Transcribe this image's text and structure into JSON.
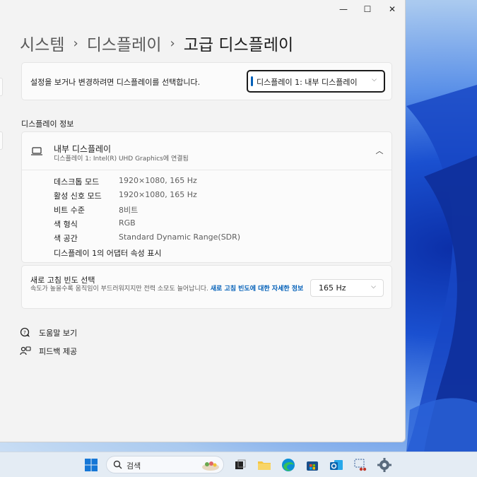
{
  "window": {
    "controls": {
      "minimize": "—",
      "maximize": "☐",
      "close": "✕"
    }
  },
  "breadcrumb": {
    "items": [
      "시스템",
      "디스플레이",
      "고급 디스플레이"
    ],
    "separator": "›"
  },
  "display_select": {
    "label": "설정을 보거나 변경하려면 디스플레이를 선택합니다.",
    "value": "디스플레이 1: 내부 디스플레이"
  },
  "display_info": {
    "section_title": "디스플레이 정보",
    "name": "내부 디스플레이",
    "subtitle": "디스플레이 1: Intel(R) UHD Graphics에 연결됨",
    "specs": [
      {
        "label": "데스크톱 모드",
        "value": "1920×1080, 165 Hz"
      },
      {
        "label": "활성 신호 모드",
        "value": "1920×1080, 165 Hz"
      },
      {
        "label": "비트 수준",
        "value": "8비트"
      },
      {
        "label": "색 형식",
        "value": "RGB"
      },
      {
        "label": "색 공간",
        "value": "Standard Dynamic Range(SDR)"
      }
    ],
    "adapter_link": "디스플레이 1의 어댑터 속성 표시"
  },
  "refresh_rate": {
    "title": "새로 고침 빈도 선택",
    "description": "속도가 높을수록 움직임이 부드러워지지만 전력 소모도 늘어납니다.",
    "learn_more": "새로 고침 빈도에 대한 자세한 정보",
    "value": "165 Hz"
  },
  "help": {
    "get_help": "도움말 보기",
    "feedback": "피드백 제공"
  },
  "taskbar": {
    "search_placeholder": "검색"
  },
  "colors": {
    "accent": "#005fb8",
    "window_bg": "#f3f3f3",
    "card_bg": "#fbfbfb"
  }
}
